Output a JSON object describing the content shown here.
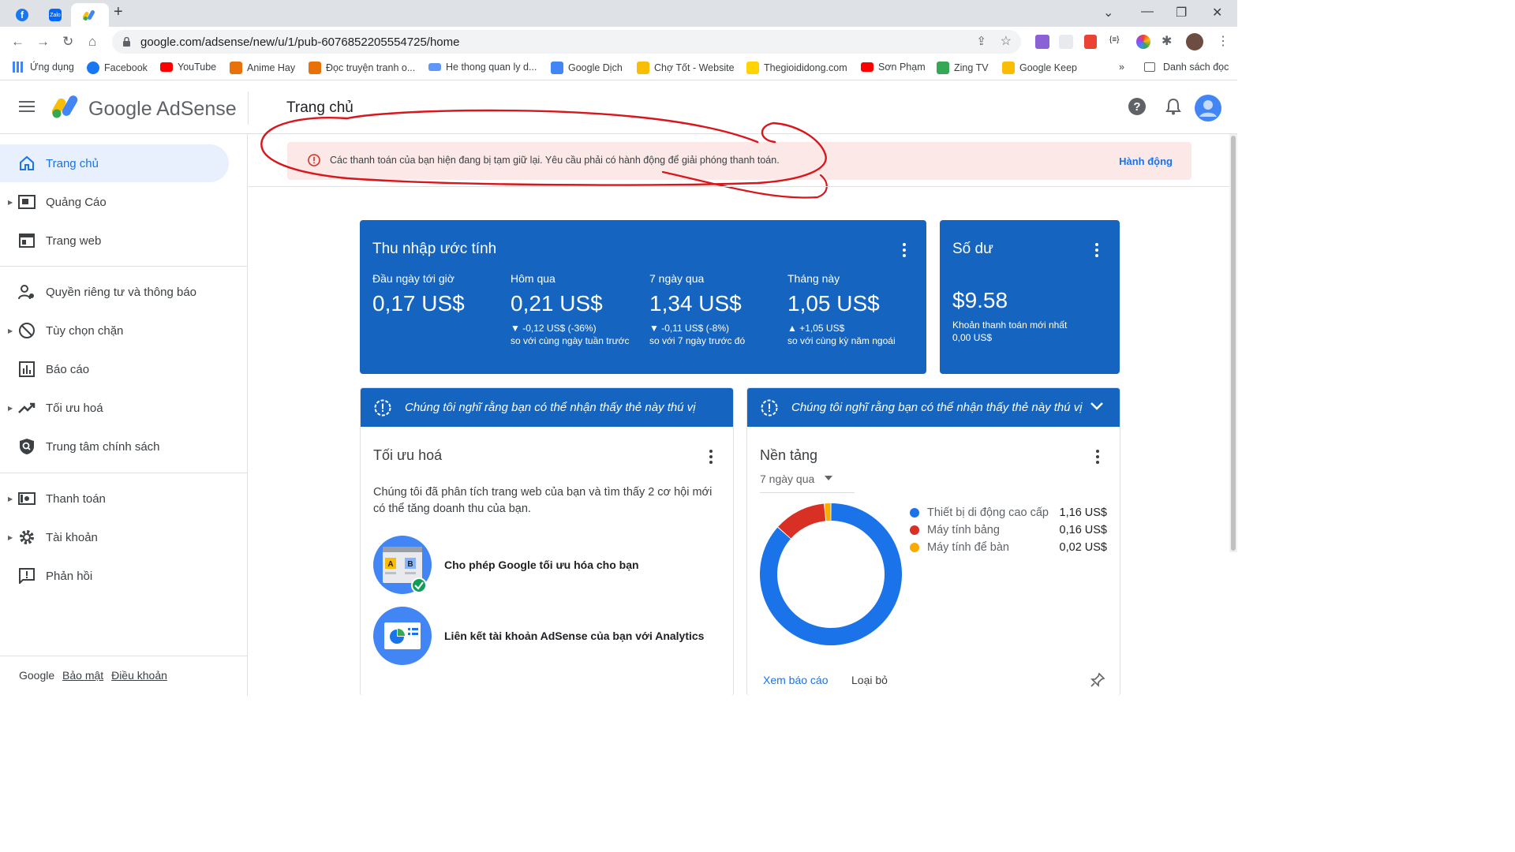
{
  "browser": {
    "url": "google.com/adsense/new/u/1/pub-6076852205554725/home",
    "bookmarks": [
      {
        "label": "Ứng dụng",
        "color": "#4285f4"
      },
      {
        "label": "Facebook",
        "color": "#1877f2"
      },
      {
        "label": "YouTube",
        "color": "#ff0000"
      },
      {
        "label": "Anime Hay",
        "color": "#e8710a"
      },
      {
        "label": "Đọc truyện tranh o...",
        "color": "#e8710a"
      },
      {
        "label": "He thong quan ly d...",
        "color": "#5e97f6"
      },
      {
        "label": "Google Dịch",
        "color": "#4285f4"
      },
      {
        "label": "Chợ Tốt - Website",
        "color": "#fbbc04"
      },
      {
        "label": "Thegioididong.com",
        "color": "#ffd400"
      },
      {
        "label": "Sơn Phạm",
        "color": "#ff0000"
      },
      {
        "label": "Zing TV",
        "color": "#34a853"
      },
      {
        "label": "Google Keep",
        "color": "#fbbc04"
      }
    ],
    "more_bookmarks": "»",
    "reading_list": "Danh sách đọc"
  },
  "header": {
    "brand": "Google AdSense",
    "page_title": "Trang chủ"
  },
  "sidebar": {
    "items": [
      {
        "label": "Trang chủ"
      },
      {
        "label": "Quảng Cáo"
      },
      {
        "label": "Trang web"
      },
      {
        "label": "Quyền riêng tư và thông báo"
      },
      {
        "label": "Tùy chọn chặn"
      },
      {
        "label": "Báo cáo"
      },
      {
        "label": "Tối ưu hoá"
      },
      {
        "label": "Trung tâm chính sách"
      },
      {
        "label": "Thanh toán"
      },
      {
        "label": "Tài khoản"
      },
      {
        "label": "Phản hồi"
      }
    ],
    "footer": {
      "google": "Google",
      "privacy": "Bảo mật",
      "terms": "Điều khoản"
    }
  },
  "alert": {
    "text": "Các thanh toán của bạn hiện đang bị tạm giữ lại. Yêu cầu phải có hành động để giải phóng thanh toán.",
    "action": "Hành động"
  },
  "earnings": {
    "title": "Thu nhập ước tính",
    "metrics": [
      {
        "label": "Đầu ngày tới giờ",
        "value": "0,17 US$",
        "delta": "",
        "sub": ""
      },
      {
        "label": "Hôm qua",
        "value": "0,21 US$",
        "delta": "▼ -0,12 US$ (-36%)",
        "sub": "so với cùng ngày tuần trước"
      },
      {
        "label": "7 ngày qua",
        "value": "1,34 US$",
        "delta": "▼ -0,11 US$ (-8%)",
        "sub": "so với 7 ngày trước đó"
      },
      {
        "label": "Tháng này",
        "value": "1,05 US$",
        "delta": "▲ +1,05 US$",
        "sub": "so với cùng kỳ năm ngoái"
      }
    ]
  },
  "balance": {
    "title": "Số dư",
    "value": "$9.58",
    "last_payment_label": "Khoản thanh toán mới nhất",
    "last_payment_value": "0,00 US$"
  },
  "optimize_card": {
    "banner": "Chúng tôi nghĩ rằng bạn có thể nhận thấy thẻ này thú vị",
    "title": "Tối ưu hoá",
    "description": "Chúng tôi đã phân tích trang web của bạn và tìm thấy 2 cơ hội mới có thể tăng doanh thu của bạn.",
    "opportunities": [
      {
        "label": "Cho phép Google tối ưu hóa cho bạn"
      },
      {
        "label": "Liên kết tài khoản AdSense của bạn với Analytics"
      }
    ]
  },
  "platform_card": {
    "banner": "Chúng tôi nghĩ rằng bạn có thể nhận thấy thẻ này thú vị",
    "title": "Nền tảng",
    "period": "7 ngày qua",
    "view_report": "Xem báo cáo",
    "dismiss": "Loại bỏ"
  },
  "chart_data": {
    "type": "pie",
    "series": [
      {
        "name": "Thiết bị di động cao cấp",
        "value": 1.16,
        "label": "1,16 US$",
        "color": "#1a73e8"
      },
      {
        "name": "Máy tính bảng",
        "value": 0.16,
        "label": "0,16 US$",
        "color": "#d93025"
      },
      {
        "name": "Máy tính để bàn",
        "value": 0.02,
        "label": "0,02 US$",
        "color": "#f9ab00"
      }
    ]
  }
}
